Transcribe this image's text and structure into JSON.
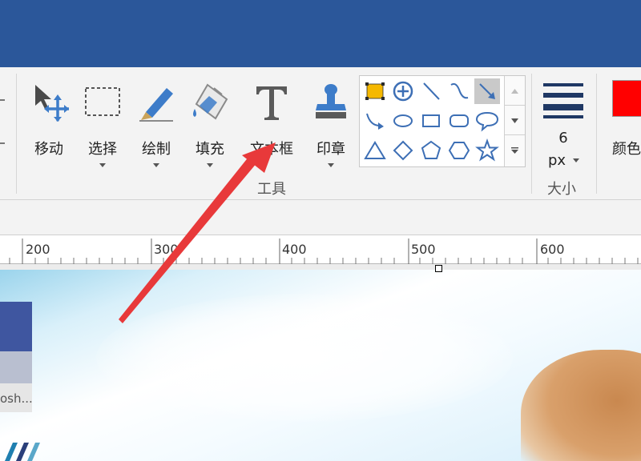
{
  "toolbar": {
    "tools": [
      {
        "id": "move",
        "label": "移动",
        "icon": "move-icon"
      },
      {
        "id": "select",
        "label": "选择",
        "icon": "select-rect-icon"
      },
      {
        "id": "draw",
        "label": "绘制",
        "icon": "pen-icon"
      },
      {
        "id": "fill",
        "label": "填充",
        "icon": "paint-bucket-icon"
      },
      {
        "id": "textbox",
        "label": "文本框",
        "icon": "text-t-icon"
      },
      {
        "id": "stamp",
        "label": "印章",
        "icon": "stamp-icon"
      }
    ],
    "group_label": "工具"
  },
  "shapes": [
    "rectangle-filled",
    "circle-plus",
    "line",
    "curve",
    "arrow",
    "curved-arrow",
    "ellipse",
    "rectangle",
    "rounded-rectangle",
    "speech-bubble",
    "triangle",
    "diamond",
    "pentagon",
    "hexagon",
    "star"
  ],
  "size": {
    "value": "6",
    "unit": "px",
    "label": "大小"
  },
  "color": {
    "label": "颜色",
    "value": "#ff0000"
  },
  "ruler": {
    "labels": [
      "200",
      "300",
      "400",
      "500",
      "600"
    ]
  },
  "canvas": {
    "thumb_text": "osh..."
  },
  "colors": {
    "titlebar": "#2b579a",
    "accent_arrow": "#e8393a",
    "selected_color": "#ff0000"
  }
}
